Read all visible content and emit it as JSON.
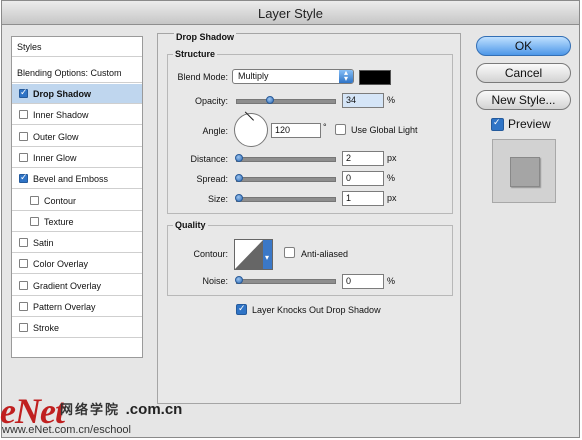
{
  "window": {
    "title": "Layer Style"
  },
  "styles_panel": {
    "header": "Styles",
    "blending_options": "Blending Options: Custom",
    "items": [
      {
        "label": "Drop Shadow",
        "checked": true,
        "selected": true,
        "indent": false
      },
      {
        "label": "Inner Shadow",
        "checked": false,
        "selected": false,
        "indent": false
      },
      {
        "label": "Outer Glow",
        "checked": false,
        "selected": false,
        "indent": false
      },
      {
        "label": "Inner Glow",
        "checked": false,
        "selected": false,
        "indent": false
      },
      {
        "label": "Bevel and Emboss",
        "checked": true,
        "selected": false,
        "indent": false
      },
      {
        "label": "Contour",
        "checked": false,
        "selected": false,
        "indent": true
      },
      {
        "label": "Texture",
        "checked": false,
        "selected": false,
        "indent": true
      },
      {
        "label": "Satin",
        "checked": false,
        "selected": false,
        "indent": false
      },
      {
        "label": "Color Overlay",
        "checked": false,
        "selected": false,
        "indent": false
      },
      {
        "label": "Gradient Overlay",
        "checked": false,
        "selected": false,
        "indent": false
      },
      {
        "label": "Pattern Overlay",
        "checked": false,
        "selected": false,
        "indent": false
      },
      {
        "label": "Stroke",
        "checked": false,
        "selected": false,
        "indent": false
      }
    ]
  },
  "drop_shadow": {
    "title": "Drop Shadow",
    "structure": {
      "title": "Structure",
      "blend_mode_label": "Blend Mode:",
      "blend_mode_value": "Multiply",
      "shadow_color": "#000000",
      "opacity_label": "Opacity:",
      "opacity_value": "34",
      "opacity_unit": "%",
      "angle_label": "Angle:",
      "angle_value": "120",
      "angle_unit": "°",
      "use_global_light_label": "Use Global Light",
      "use_global_light_checked": false,
      "distance_label": "Distance:",
      "distance_value": "2",
      "distance_unit": "px",
      "spread_label": "Spread:",
      "spread_value": "0",
      "spread_unit": "%",
      "size_label": "Size:",
      "size_value": "1",
      "size_unit": "px"
    },
    "quality": {
      "title": "Quality",
      "contour_label": "Contour:",
      "anti_aliased_label": "Anti-aliased",
      "anti_aliased_checked": false,
      "noise_label": "Noise:",
      "noise_value": "0",
      "noise_unit": "%"
    },
    "knockout_label": "Layer Knocks Out Drop Shadow",
    "knockout_checked": true
  },
  "buttons": {
    "ok": "OK",
    "cancel": "Cancel",
    "new_style": "New Style...",
    "preview_label": "Preview",
    "preview_checked": true
  },
  "watermark": {
    "logo": "eNet",
    "chinese": "网络学院",
    "domain": ".com.cn",
    "url": "www.eNet.com.cn/eschool"
  }
}
